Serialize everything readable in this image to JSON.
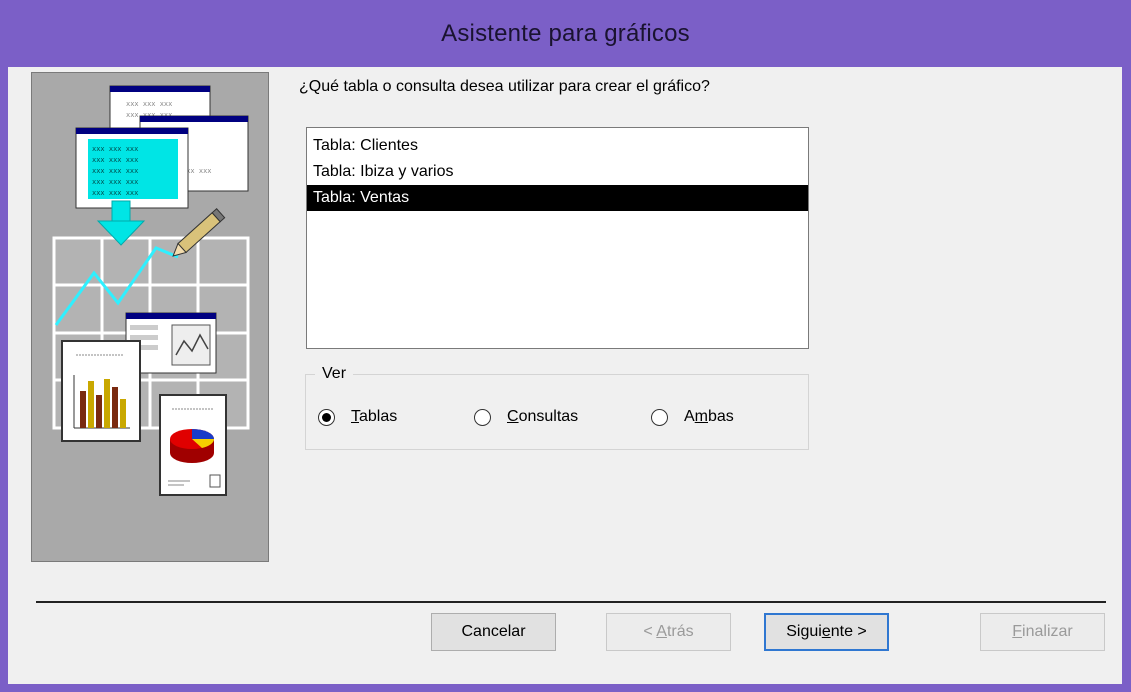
{
  "window": {
    "title": "Asistente para gráficos"
  },
  "question": "¿Qué tabla o consulta desea utilizar para crear el gráfico?",
  "list": {
    "items": [
      {
        "label": "Tabla: Clientes",
        "selected": false
      },
      {
        "label": "Tabla: Ibiza y varios",
        "selected": false
      },
      {
        "label": "Tabla: Ventas",
        "selected": true
      }
    ]
  },
  "view_group": {
    "legend": "Ver",
    "options": [
      {
        "label": "Tablas",
        "accel": "T",
        "rest": "ablas",
        "checked": true
      },
      {
        "label": "Consultas",
        "accel": "C",
        "rest": "onsultas",
        "checked": false
      },
      {
        "label": "Ambas",
        "pre": "A",
        "accel": "m",
        "rest": "bas",
        "checked": false
      }
    ]
  },
  "illustration": {
    "cell_text": "xxx xxx xxx"
  },
  "buttons": {
    "cancel": "Cancelar",
    "back": {
      "label": "< Atrás",
      "pre": "< ",
      "accel": "A",
      "rest": "trás",
      "enabled": false
    },
    "next": {
      "label": "Siguiente >",
      "pre": "Sigui",
      "accel": "e",
      "rest": "nte >",
      "enabled": true
    },
    "finish": {
      "label": "Finalizar",
      "accel": "F",
      "rest": "inalizar",
      "enabled": false
    }
  },
  "colors": {
    "titlebar": "#7b5fc7",
    "selection": "#000000",
    "default_button_border": "#2f77d1"
  }
}
